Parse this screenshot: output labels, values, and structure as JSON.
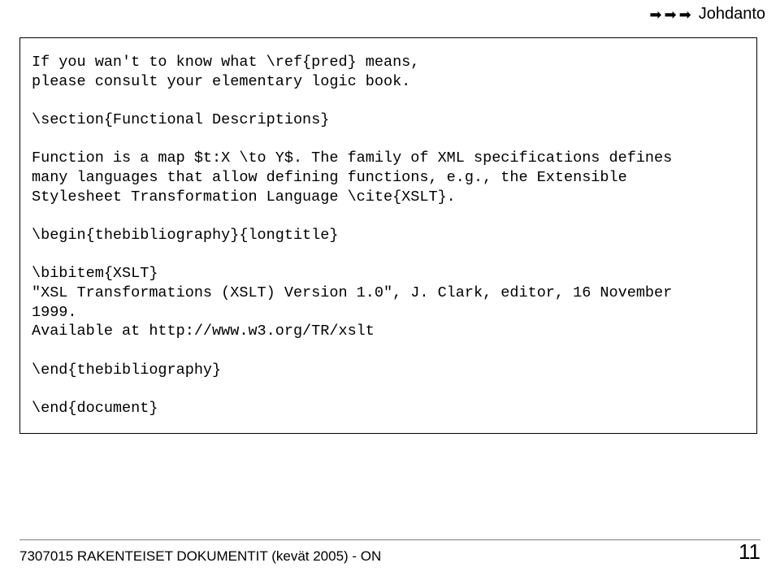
{
  "header": {
    "section": "Johdanto"
  },
  "code": {
    "line1": "If you wan't to know what \\ref{pred} means,",
    "line2": "please consult your elementary logic book.",
    "line3": "",
    "line4": "\\section{Functional Descriptions}",
    "line5": "",
    "line6": "Function is a map $t:X \\to Y$. The family of XML specifications defines",
    "line7": "many languages that allow defining functions, e.g., the Extensible",
    "line8": "Stylesheet Transformation Language \\cite{XSLT}.",
    "line9": "",
    "line10": "\\begin{thebibliography}{longtitle}",
    "line11": "",
    "line12": "\\bibitem{XSLT}",
    "line13": "\"XSL Transformations (XSLT) Version 1.0\", J. Clark, editor, 16 November",
    "line14": "1999.",
    "line15": "Available at http://www.w3.org/TR/xslt",
    "line16": "",
    "line17": "\\end{thebibliography}",
    "line18": "",
    "line19": "\\end{document}"
  },
  "footer": {
    "left": "7307015 RAKENTEISET DOKUMENTIT (kevät 2005) - ON",
    "page": "11"
  }
}
